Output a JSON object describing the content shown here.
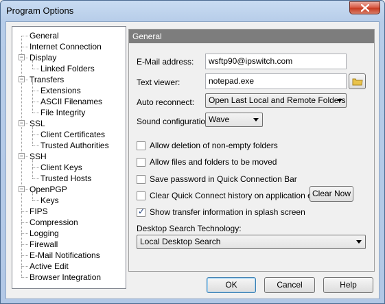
{
  "window": {
    "title": "Program Options"
  },
  "tree": {
    "items": [
      {
        "label": "General",
        "level": 0,
        "expander": ""
      },
      {
        "label": "Internet Connection",
        "level": 0,
        "expander": ""
      },
      {
        "label": "Display",
        "level": 0,
        "expander": "minus"
      },
      {
        "label": "Linked Folders",
        "level": 1,
        "expander": ""
      },
      {
        "label": "Transfers",
        "level": 0,
        "expander": "minus"
      },
      {
        "label": "Extensions",
        "level": 1,
        "expander": ""
      },
      {
        "label": "ASCII Filenames",
        "level": 1,
        "expander": ""
      },
      {
        "label": "File Integrity",
        "level": 1,
        "expander": ""
      },
      {
        "label": "SSL",
        "level": 0,
        "expander": "minus"
      },
      {
        "label": "Client Certificates",
        "level": 1,
        "expander": ""
      },
      {
        "label": "Trusted Authorities",
        "level": 1,
        "expander": ""
      },
      {
        "label": "SSH",
        "level": 0,
        "expander": "minus"
      },
      {
        "label": "Client Keys",
        "level": 1,
        "expander": ""
      },
      {
        "label": "Trusted Hosts",
        "level": 1,
        "expander": ""
      },
      {
        "label": "OpenPGP",
        "level": 0,
        "expander": "minus"
      },
      {
        "label": "Keys",
        "level": 1,
        "expander": ""
      },
      {
        "label": "FIPS",
        "level": 0,
        "expander": ""
      },
      {
        "label": "Compression",
        "level": 0,
        "expander": ""
      },
      {
        "label": "Logging",
        "level": 0,
        "expander": ""
      },
      {
        "label": "Firewall",
        "level": 0,
        "expander": ""
      },
      {
        "label": "E-Mail Notifications",
        "level": 0,
        "expander": ""
      },
      {
        "label": "Active Edit",
        "level": 0,
        "expander": ""
      },
      {
        "label": "Browser Integration",
        "level": 0,
        "expander": ""
      }
    ]
  },
  "panel": {
    "header": "General",
    "email_label": "E-Mail address:",
    "email_value": "wsftp90@ipswitch.com",
    "viewer_label": "Text viewer:",
    "viewer_value": "notepad.exe",
    "reconnect_label": "Auto reconnect:",
    "reconnect_value": "Open Last Local and Remote Folders",
    "sound_label": "Sound configuration:",
    "sound_value": "Wave",
    "checkboxes": [
      {
        "label": "Allow deletion of non-empty folders",
        "checked": false
      },
      {
        "label": "Allow files and folders to be moved",
        "checked": false
      },
      {
        "label": "Save password in Quick Connection Bar",
        "checked": false
      },
      {
        "label": "Clear Quick Connect history on application exit",
        "checked": false
      },
      {
        "label": "Show transfer information in splash screen",
        "checked": true
      }
    ],
    "clear_now_label": "Clear Now",
    "search_label": "Desktop Search Technology:",
    "search_value": "Local Desktop Search"
  },
  "buttons": {
    "ok": "OK",
    "cancel": "Cancel",
    "help": "Help"
  }
}
